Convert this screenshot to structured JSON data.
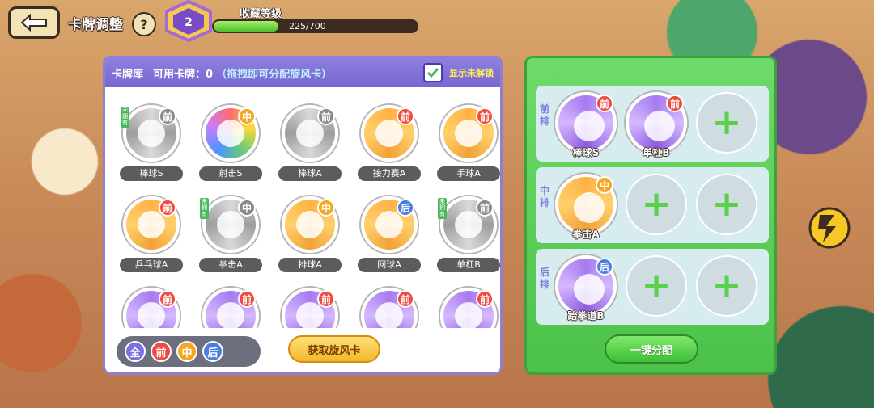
{
  "header": {
    "title": "卡牌调整",
    "help": "?",
    "badge_level": "2",
    "level_label": "收藏等级",
    "level_text": "225/700",
    "level_progress": 0.32
  },
  "library": {
    "title": "卡牌库",
    "available": "可用卡牌：0",
    "hint": "（拖拽即可分配旋风卡）",
    "show_locked": "显示未解锁",
    "show_locked_checked": true
  },
  "cards": [
    {
      "name": "棒球S",
      "pos": "前",
      "rim": "gray",
      "pos_color": "#8a8a8a",
      "locked": true,
      "lock_text": "未拥有"
    },
    {
      "name": "射击S",
      "pos": "中",
      "rim": "rainbow",
      "pos_color": "#f5a623",
      "locked": false
    },
    {
      "name": "棒球A",
      "pos": "前",
      "rim": "gray",
      "pos_color": "#8a8a8a",
      "locked": false
    },
    {
      "name": "接力赛A",
      "pos": "前",
      "rim": "orange",
      "pos_color": "#ef4b3f",
      "locked": false
    },
    {
      "name": "手球A",
      "pos": "前",
      "rim": "orange",
      "pos_color": "#ef4b3f",
      "locked": false
    },
    {
      "name": "乒乓球A",
      "pos": "前",
      "rim": "orange",
      "pos_color": "#ef4b3f",
      "locked": false
    },
    {
      "name": "拳击A",
      "pos": "中",
      "rim": "gray",
      "pos_color": "#8a8a8a",
      "locked": true,
      "lock_text": "未拥有"
    },
    {
      "name": "排球A",
      "pos": "中",
      "rim": "orange",
      "pos_color": "#f5a623",
      "locked": false
    },
    {
      "name": "网球A",
      "pos": "后",
      "rim": "orange",
      "pos_color": "#4a7fe0",
      "locked": false
    },
    {
      "name": "单杠B",
      "pos": "前",
      "rim": "gray",
      "pos_color": "#8a8a8a",
      "locked": true,
      "lock_text": "未拥有"
    },
    {
      "name": "",
      "pos": "前",
      "rim": "purple",
      "pos_color": "#ef4b3f",
      "locked": false
    },
    {
      "name": "",
      "pos": "前",
      "rim": "purple",
      "pos_color": "#ef4b3f",
      "locked": false
    },
    {
      "name": "",
      "pos": "前",
      "rim": "purple",
      "pos_color": "#ef4b3f",
      "locked": false
    },
    {
      "name": "",
      "pos": "前",
      "rim": "purple",
      "pos_color": "#ef4b3f",
      "locked": false
    },
    {
      "name": "",
      "pos": "前",
      "rim": "purple",
      "pos_color": "#ef4b3f",
      "locked": false
    }
  ],
  "filters": [
    {
      "label": "全",
      "color": "#7c6fe0"
    },
    {
      "label": "前",
      "color": "#ef4b3f"
    },
    {
      "label": "中",
      "color": "#f5a623"
    },
    {
      "label": "后",
      "color": "#4a7fe0"
    }
  ],
  "get_button": "获取旋风卡",
  "lineup": {
    "rows": [
      {
        "label": "前排",
        "slots": [
          {
            "name": "棒球S",
            "pos": "前",
            "rim": "purple",
            "pos_color": "#ef4b3f"
          },
          {
            "name": "单杠B",
            "pos": "前",
            "rim": "purple",
            "pos_color": "#ef4b3f"
          },
          null
        ]
      },
      {
        "label": "中排",
        "slots": [
          {
            "name": "拳击A",
            "pos": "中",
            "rim": "orange",
            "pos_color": "#f5a623"
          },
          null,
          null
        ]
      },
      {
        "label": "后排",
        "slots": [
          {
            "name": "跆拳道B",
            "pos": "后",
            "rim": "purple",
            "pos_color": "#4a7fe0"
          },
          null,
          null
        ]
      }
    ],
    "plus": "+",
    "assign_button": "一键分配"
  }
}
